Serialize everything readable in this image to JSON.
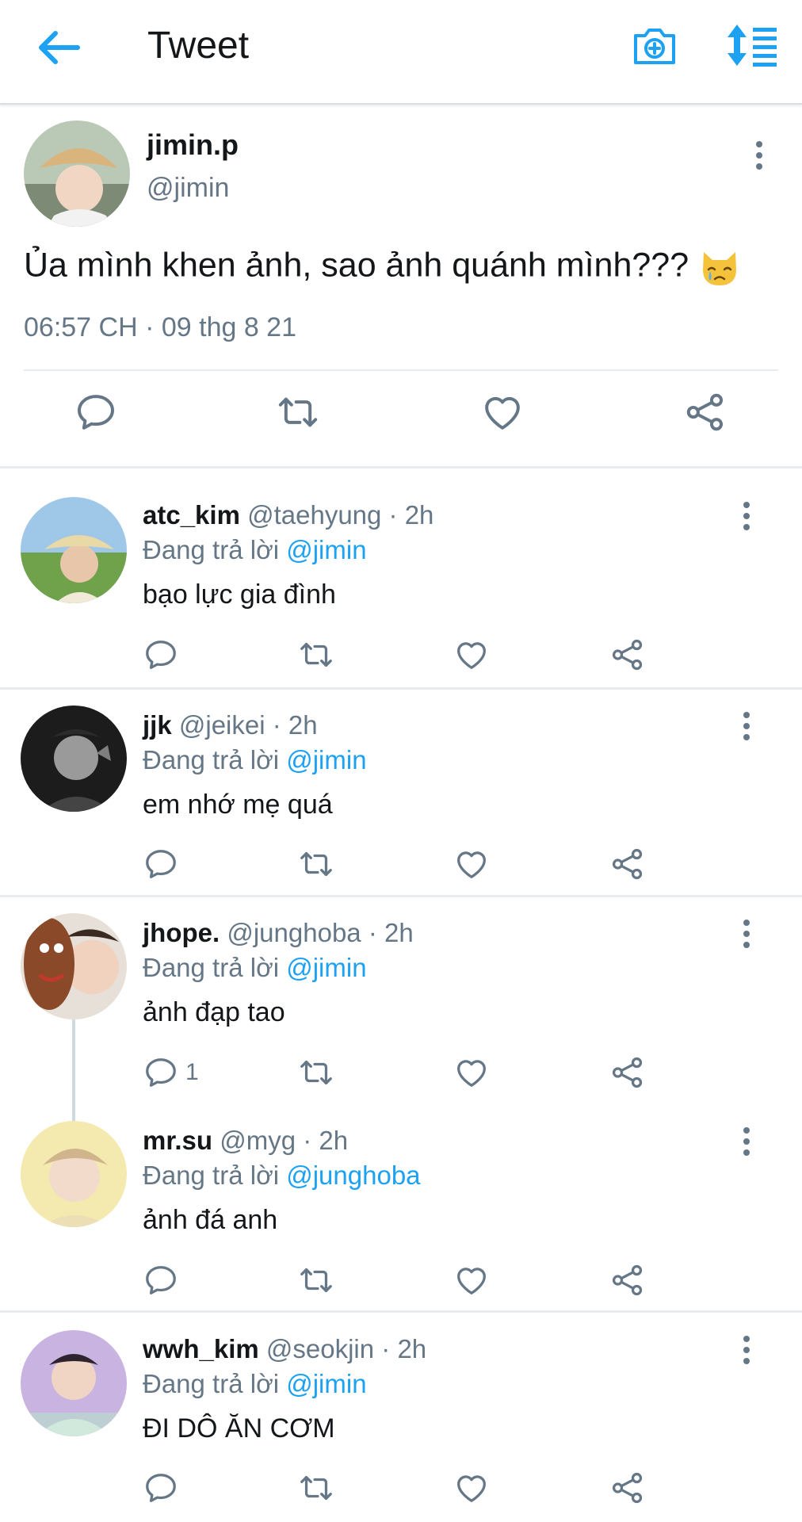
{
  "header": {
    "title": "Tweet",
    "icons": [
      "back-arrow-icon",
      "camera-add-icon",
      "sort-icon"
    ],
    "accent": "#1da1f2"
  },
  "main_tweet": {
    "name": "jimin.p",
    "handle": "@jimin",
    "text": "Ủa mình khen ảnh, sao ảnh quánh mình???",
    "emoji": "crying-cat-face",
    "timestamp": "06:57 CH · 09 thg 8 21"
  },
  "replies": [
    {
      "name": "atc_kim",
      "meta": "@taehyung · 2h",
      "replying_label": "Đang trả lời",
      "mention": "@jimin",
      "text": "bạo lực gia đình",
      "reply_count": ""
    },
    {
      "name": "jjk",
      "meta": "@jeikei · 2h",
      "replying_label": "Đang trả lời",
      "mention": "@jimin",
      "text": "em nhớ mẹ quá",
      "reply_count": ""
    },
    {
      "name": "jhope.",
      "meta": "@junghoba · 2h",
      "replying_label": "Đang trả lời",
      "mention": "@jimin",
      "text": "ảnh đạp tao",
      "reply_count": "1"
    },
    {
      "name": "mr.su",
      "meta": "@myg · 2h",
      "replying_label": "Đang trả lời",
      "mention": "@junghoba",
      "text": "ảnh đá anh",
      "reply_count": ""
    },
    {
      "name": "wwh_kim",
      "meta": "@seokjin · 2h",
      "replying_label": "Đang trả lời",
      "mention": "@jimin",
      "text": "ĐI DÔ ĂN CƠM",
      "reply_count": ""
    }
  ]
}
